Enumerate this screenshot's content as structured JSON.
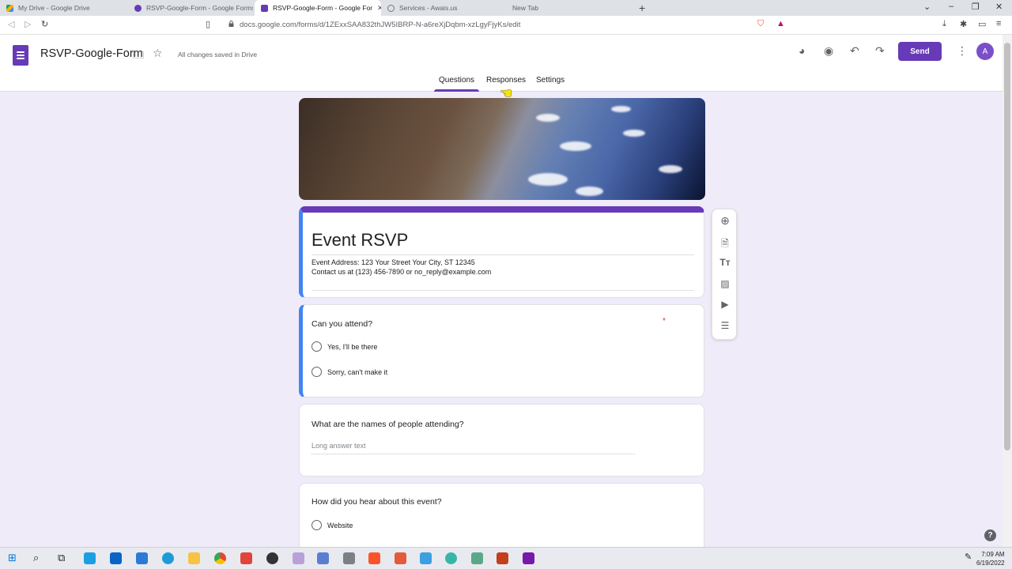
{
  "browser": {
    "tabs": [
      {
        "label": "My Drive - Google Drive",
        "active": false
      },
      {
        "label": "RSVP-Google-Form - Google Forms",
        "active": false
      },
      {
        "label": "RSVP-Google-Form - Google For",
        "active": true
      },
      {
        "label": "Services - Awais.us",
        "active": false
      },
      {
        "label": "New Tab",
        "active": false
      }
    ],
    "url": "docs.google.com/forms/d/1ZExxSAA832thJW5IBRP-N-a6reXjDqbm-xzLgyFjyKs/edit"
  },
  "header": {
    "doc_title": "RSVP-Google-Form",
    "save_status": "All changes saved in Drive",
    "send_label": "Send",
    "avatar_initial": "A",
    "tabs": [
      "Questions",
      "Responses",
      "Settings"
    ],
    "active_tab": "Questions"
  },
  "form": {
    "title": "Event RSVP",
    "description_lines": [
      "Event Address: 123 Your Street Your City, ST 12345",
      "Contact us at (123) 456-7890 or no_reply@example.com"
    ],
    "questions": [
      {
        "title": "Can you attend?",
        "required_mark": "*",
        "options": [
          "Yes,  I'll be there",
          "Sorry, can't make it"
        ]
      },
      {
        "title": "What are the names of people attending?",
        "placeholder": "Long answer text"
      },
      {
        "title": "How did you hear about this event?",
        "options": [
          "Website"
        ]
      }
    ]
  },
  "toolbar_icons": [
    "add-question-icon",
    "import-questions-icon",
    "add-title-icon",
    "add-image-icon",
    "add-video-icon",
    "add-section-icon"
  ],
  "taskbar": {
    "time": "7:09 AM",
    "date": "6/19/2022"
  },
  "colors": {
    "accent": "#673ab7",
    "focus_border": "#4285f4",
    "background": "#f0ebf8"
  }
}
